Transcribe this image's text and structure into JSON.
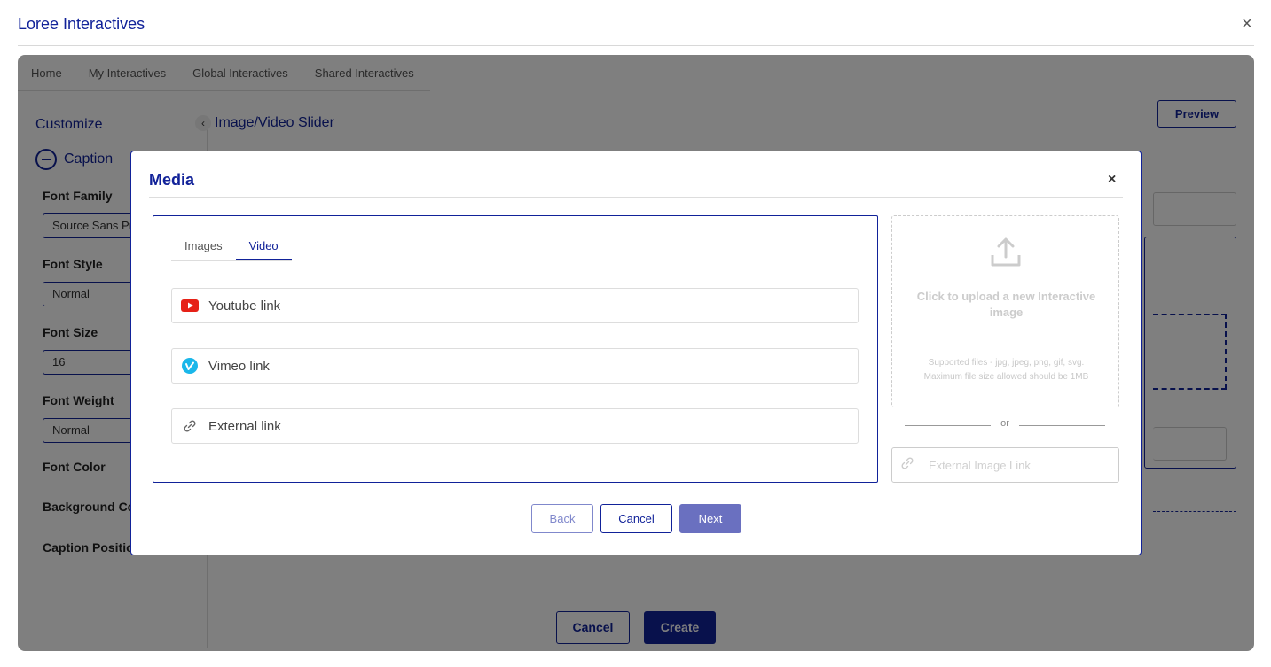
{
  "app": {
    "title": "Loree Interactives",
    "close": "×"
  },
  "nav": {
    "items": [
      "Home",
      "My Interactives",
      "Global Interactives",
      "Shared Interactives"
    ]
  },
  "sidebar": {
    "heading": "Customize",
    "section": "Caption",
    "fields": [
      {
        "label": "Font Family",
        "value": "Source Sans Pro"
      },
      {
        "label": "Font Style",
        "value": "Normal"
      },
      {
        "label": "Font Size",
        "value": "16"
      },
      {
        "label": "Font Weight",
        "value": "Normal"
      }
    ],
    "font_color_label": "Font Color",
    "background_color_label": "Background Color",
    "caption_position_label": "Caption Position"
  },
  "editor": {
    "title": "Image/Video Slider",
    "preview_label": "Preview",
    "collapse_icon": "chevron-left-icon"
  },
  "footer": {
    "cancel_label": "Cancel",
    "create_label": "Create"
  },
  "modal": {
    "title": "Media",
    "close": "×",
    "tabs": [
      {
        "label": "Images",
        "active": false
      },
      {
        "label": "Video",
        "active": true
      }
    ],
    "links": [
      {
        "icon": "youtube-icon",
        "placeholder": "Youtube link"
      },
      {
        "icon": "vimeo-icon",
        "placeholder": "Vimeo link"
      },
      {
        "icon": "link-icon",
        "placeholder": "External link"
      }
    ],
    "upload": {
      "icon": "upload-icon",
      "title": "Click to upload a new Interactive image",
      "supported": "Supported files - jpg, jpeg, png, gif, svg.",
      "max_size": "Maximum file size allowed should be 1MB"
    },
    "or_text": "or",
    "external_image_placeholder": "External Image Link",
    "buttons": {
      "back": "Back",
      "cancel": "Cancel",
      "next": "Next"
    }
  },
  "colors": {
    "brand": "#112299",
    "next_button": "#6a70c0",
    "youtube_red": "#e62117",
    "vimeo_blue": "#1ab7ea"
  }
}
